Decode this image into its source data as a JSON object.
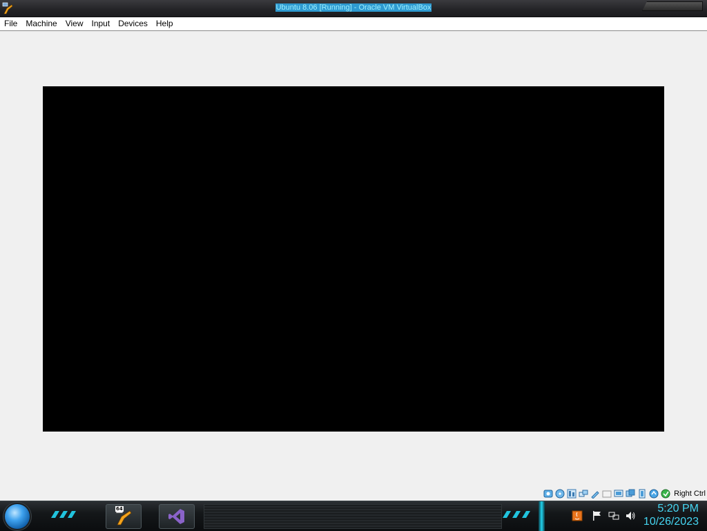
{
  "window": {
    "title": "Ubuntu 8.06 [Running] - Oracle VM VirtualBox",
    "app_icon": "virtualbox-icon"
  },
  "menu": [
    "File",
    "Machine",
    "View",
    "Input",
    "Devices",
    "Help"
  ],
  "statusbar": {
    "icons": [
      "hard-disk-icon",
      "optical-drive-icon",
      "audio-icon",
      "network-icon",
      "usb-icon",
      "shared-folders-icon",
      "display-icon",
      "video-capture-icon",
      "cpu-icon",
      "mouse-integration-icon",
      "keyboard-icon"
    ],
    "host_key": "Right Ctrl"
  },
  "taskbar": {
    "start": "start-orb",
    "pinned": [
      {
        "icon": "virtualbox-icon",
        "badge": "64"
      },
      {
        "icon": "visual-studio-icon"
      }
    ],
    "tray_icons": [
      "java-update-icon",
      "action-center-flag-icon",
      "network-icon",
      "volume-icon"
    ],
    "clock": {
      "time": "5:20 PM",
      "date": "10/26/2023"
    }
  },
  "colors": {
    "accent_cyan": "#46d6f2",
    "title_highlight": "#2e9ad0",
    "vm_screen": "#000000"
  }
}
